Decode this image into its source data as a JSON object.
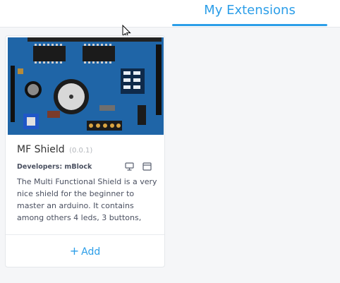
{
  "header": {
    "active_tab": "My Extensions"
  },
  "extension": {
    "name": "MF Shield",
    "version": "(0.0.1)",
    "developers": "Developers: mBlock",
    "description": "The Multi Functional Shield is a very nice shield for the beginner to master an arduino. It contains among others 4 leds, 3 buttons,",
    "add_label": "Add",
    "add_icon": "+",
    "platform_icons": [
      "desktop-icon",
      "browser-window-icon"
    ]
  },
  "colors": {
    "accent": "#2c9ee8",
    "board_blue": "#1a5fa0"
  }
}
